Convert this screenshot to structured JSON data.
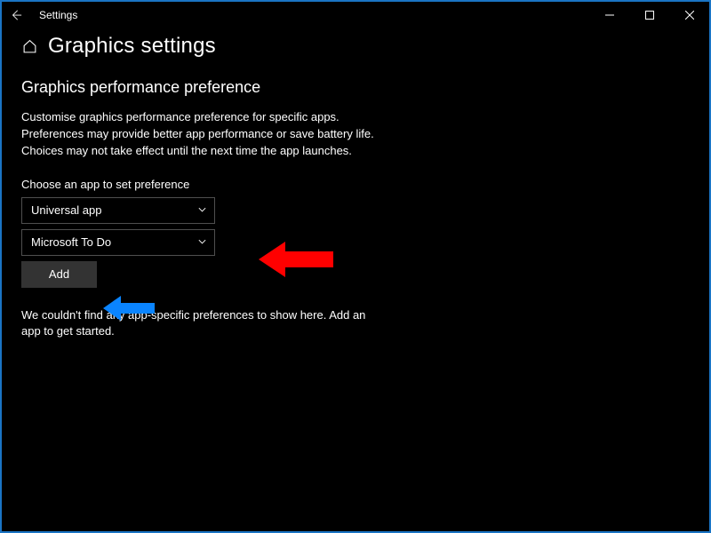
{
  "titlebar": {
    "app": "Settings"
  },
  "header": {
    "title": "Graphics settings"
  },
  "section": {
    "title": "Graphics performance preference",
    "desc": "Customise graphics performance preference for specific apps. Preferences may provide better app performance or save battery life. Choices may not take effect until the next time the app launches.",
    "choose_label": "Choose an app to set preference",
    "dropdown_app_type": "Universal app",
    "dropdown_app_selected": "Microsoft To Do",
    "add_label": "Add",
    "empty": "We couldn't find any app-specific preferences to show here. Add an app to get started."
  },
  "annotations": {
    "red_arrow": "red-arrow",
    "blue_arrow": "blue-arrow"
  }
}
